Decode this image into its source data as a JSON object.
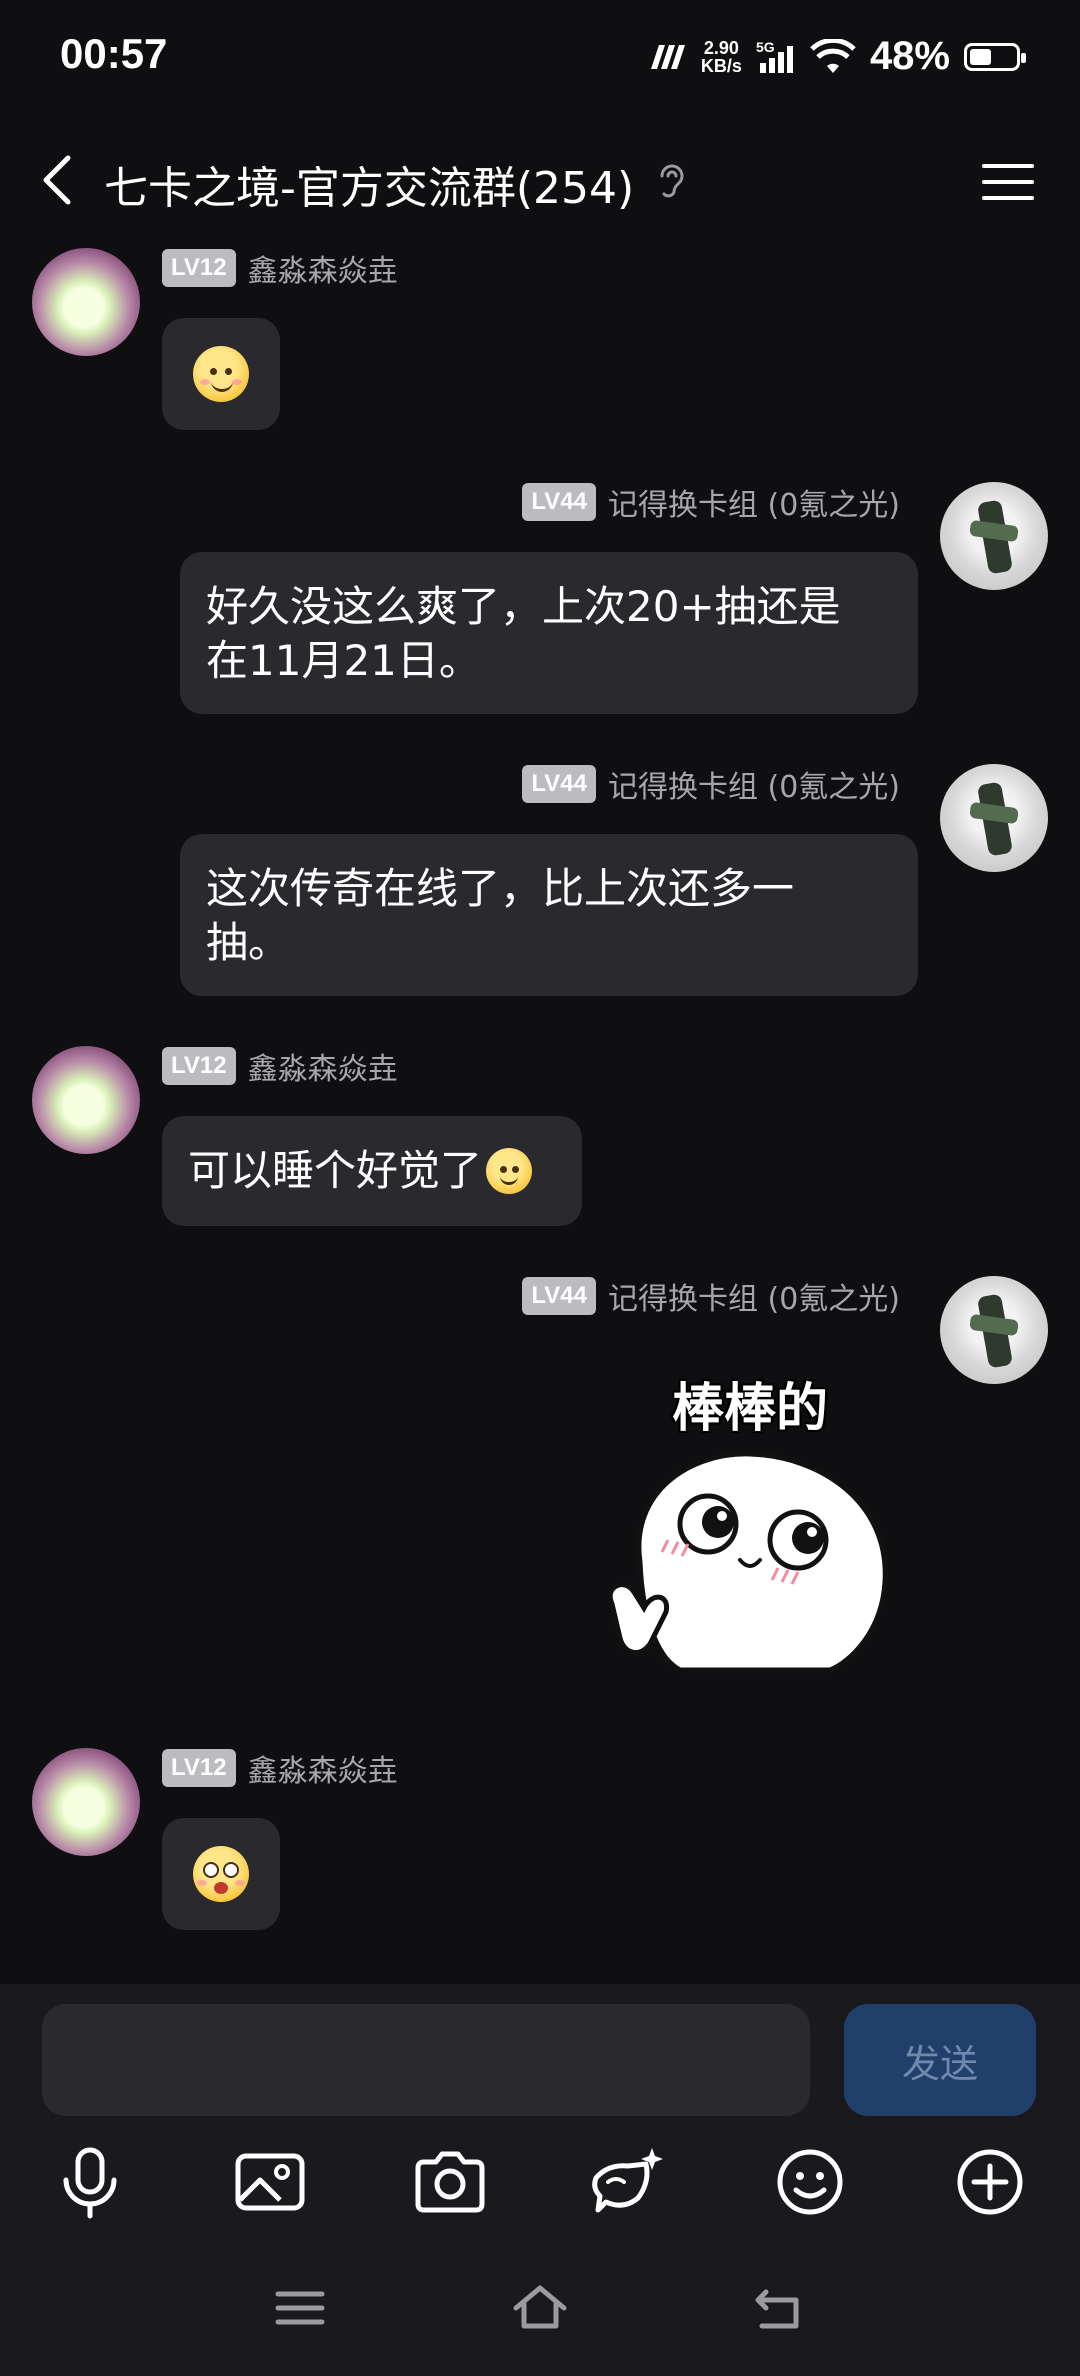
{
  "status_bar": {
    "time": "00:57",
    "net_speed_value": "2.90",
    "net_speed_unit": "KB/s",
    "network_type": "5G",
    "battery_percent_text": "48%",
    "battery_level": 0.48
  },
  "header": {
    "title": "七卡之境-官方交流群(254)"
  },
  "messages": [
    {
      "side": "left",
      "level": "LV12",
      "sender": "鑫淼森焱垚",
      "content_type": "emoji",
      "emoji": "slightly-smiling-face"
    },
    {
      "side": "right",
      "level": "LV44",
      "sender": "记得换卡组 (0氪之光)",
      "line1": "好久没这么爽了，上次20+抽还是",
      "line2": "在11月21日。"
    },
    {
      "side": "right",
      "level": "LV44",
      "sender": "记得换卡组 (0氪之光)",
      "line1": "这次传奇在线了，比上次还多一",
      "line2": "抽。"
    },
    {
      "side": "left",
      "level": "LV12",
      "sender": "鑫淼森焱垚",
      "text": "可以睡个好觉了",
      "emoji": "slightly-smiling-face"
    },
    {
      "side": "right",
      "level": "LV44",
      "sender": "记得换卡组 (0氪之光)",
      "content_type": "sticker",
      "sticker_text": "棒棒的"
    },
    {
      "side": "left",
      "level": "LV12",
      "sender": "鑫淼森焱垚",
      "content_type": "emoji",
      "emoji": "pleading-face"
    }
  ],
  "composer": {
    "input_value": "",
    "send_label": "发送"
  },
  "toolbar": {
    "icons": [
      "microphone-icon",
      "image-icon",
      "camera-icon",
      "ai-assistant-icon",
      "emoji-icon",
      "plus-icon"
    ]
  },
  "colors": {
    "background": "#0f0f12",
    "bubble": "#2a2a2e",
    "send_button": "#213f6b",
    "level_badge": "#bcbcc0"
  }
}
